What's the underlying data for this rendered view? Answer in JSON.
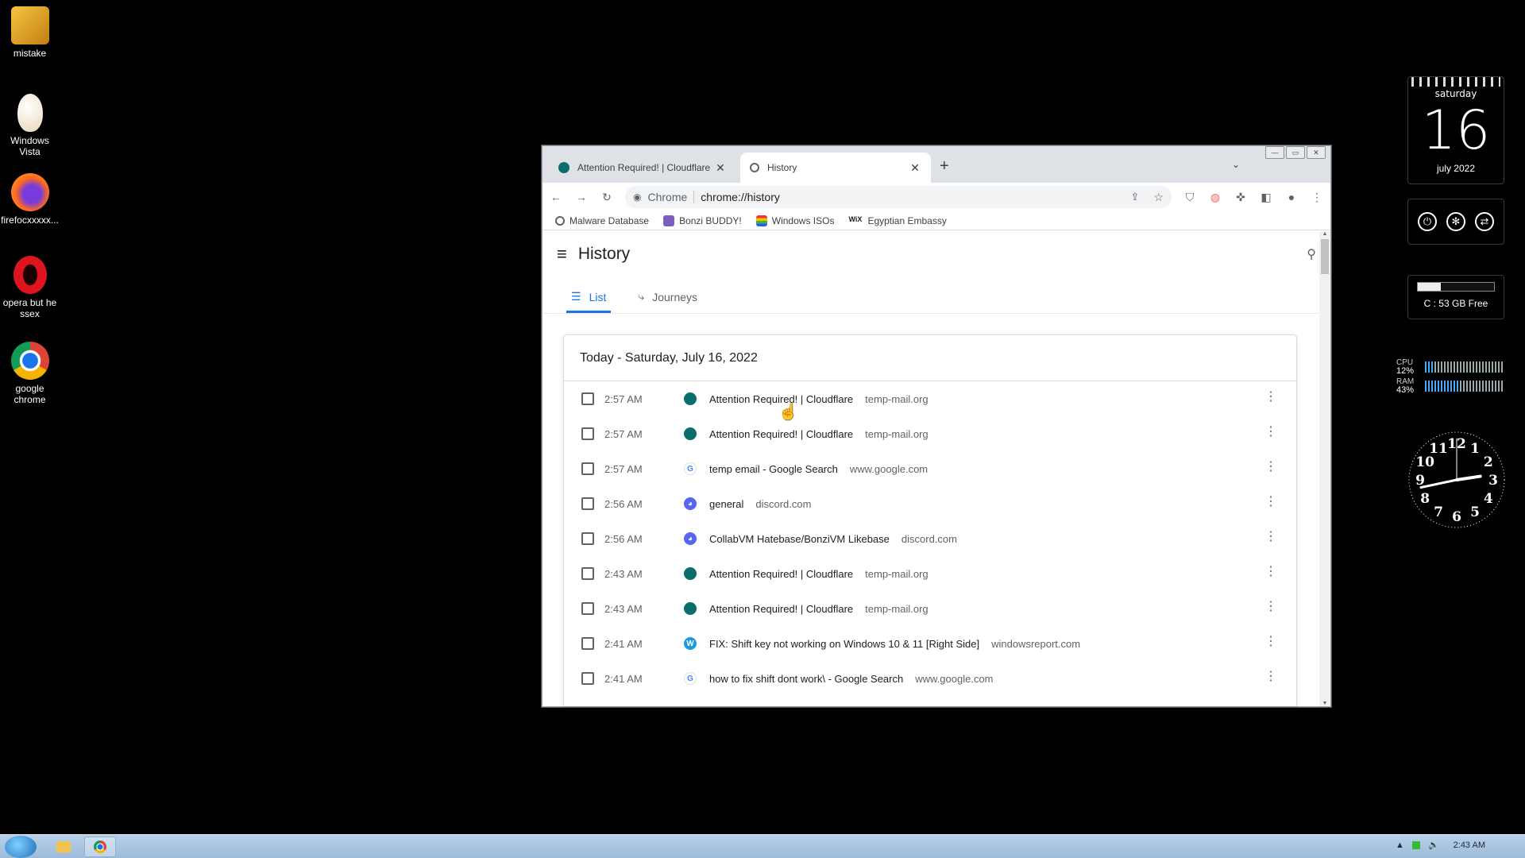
{
  "desktop": {
    "icons": [
      {
        "label": "mistake"
      },
      {
        "label": "Windows Vista"
      },
      {
        "label": "firefocxxxxx..."
      },
      {
        "label": "opera but he ssex"
      },
      {
        "label": "google chrome"
      }
    ]
  },
  "gadgets": {
    "calendar": {
      "weekday": "saturday",
      "day": "16",
      "month": "july 2022"
    },
    "drive": {
      "label": "C : 53 GB Free",
      "used_fraction": 0.3
    },
    "meter": {
      "cpu_label": "CPU",
      "cpu_value": "12%",
      "ram_label": "RAM",
      "ram_value": "43%",
      "cpu_fraction": 0.12,
      "ram_fraction": 0.43,
      "scale_min": "0",
      "scale_mid": "50",
      "scale_max": "100"
    },
    "clock": {
      "numbers": [
        "12",
        "1",
        "2",
        "3",
        "4",
        "5",
        "6",
        "7",
        "8",
        "9",
        "10",
        "11"
      ],
      "hours": 2,
      "minutes": 43
    }
  },
  "browser": {
    "tabs": [
      {
        "title": "Attention Required! | Cloudflare",
        "active": false
      },
      {
        "title": "History",
        "active": true
      }
    ],
    "omnibox": {
      "chip": "Chrome",
      "url": "chrome://history"
    },
    "bookmarks": [
      {
        "label": "Malware Database"
      },
      {
        "label": "Bonzi BUDDY!"
      },
      {
        "label": "Windows ISOs"
      },
      {
        "label": "Egyptian Embassy"
      }
    ],
    "history": {
      "title": "History",
      "tab_list": "List",
      "tab_journeys": "Journeys",
      "date_heading": "Today - Saturday, July 16, 2022",
      "rows": [
        {
          "time": "2:57 AM",
          "title": "Attention Required! | Cloudflare",
          "domain": "temp-mail.org",
          "icon": "cloudflare-favicon"
        },
        {
          "time": "2:57 AM",
          "title": "Attention Required! | Cloudflare",
          "domain": "temp-mail.org",
          "icon": "cloudflare-favicon"
        },
        {
          "time": "2:57 AM",
          "title": "temp email - Google Search",
          "domain": "www.google.com",
          "icon": "google-favicon"
        },
        {
          "time": "2:56 AM",
          "title": "general",
          "domain": "discord.com",
          "icon": "discord-favicon"
        },
        {
          "time": "2:56 AM",
          "title": "CollabVM Hatebase/BonziVM Likebase",
          "domain": "discord.com",
          "icon": "discord-favicon"
        },
        {
          "time": "2:43 AM",
          "title": "Attention Required! | Cloudflare",
          "domain": "temp-mail.org",
          "icon": "cloudflare-favicon"
        },
        {
          "time": "2:43 AM",
          "title": "Attention Required! | Cloudflare",
          "domain": "temp-mail.org",
          "icon": "cloudflare-favicon"
        },
        {
          "time": "2:41 AM",
          "title": "FIX: Shift key not working on Windows 10 & 11 [Right Side]",
          "domain": "windowsreport.com",
          "icon": "windowsreport-favicon"
        },
        {
          "time": "2:41 AM",
          "title": "how to fix shift dont work\\ - Google Search",
          "domain": "www.google.com",
          "icon": "google-favicon"
        }
      ]
    }
  },
  "taskbar": {
    "clock": "2:43 AM"
  },
  "colors": {
    "accent": "#1a73e8",
    "cloudflare": "#0b6e6e",
    "discord": "#5865f2",
    "google": "#ffffff",
    "windowsreport": "#1a9be0"
  }
}
